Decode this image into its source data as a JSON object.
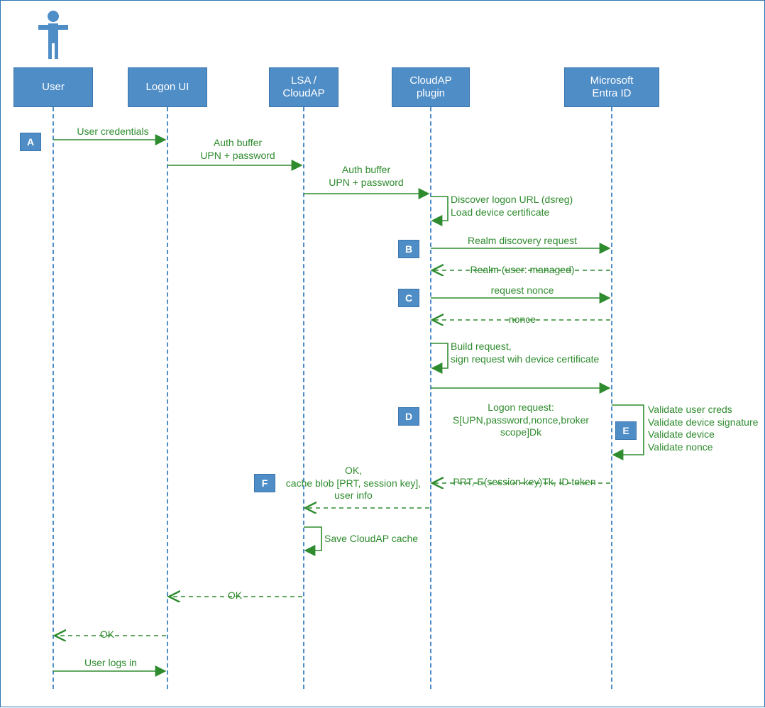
{
  "participants": {
    "user": "User",
    "logonui": "Logon UI",
    "lsa": "LSA /\nCloudAP",
    "cloudap": "CloudAP\nplugin",
    "entra": "Microsoft\nEntra ID"
  },
  "steps": {
    "A": "A",
    "B": "B",
    "C": "C",
    "D": "D",
    "E": "E",
    "F": "F"
  },
  "labels": {
    "user_creds": "User credentials",
    "auth_buffer1": "Auth buffer\nUPN + password",
    "auth_buffer2": "Auth buffer\nUPN + password",
    "discover": "Discover logon URL (dsreg)\nLoad device certificate",
    "realm_req": "Realm discovery request",
    "realm_resp": "Realm (user: managed)",
    "req_nonce": "request nonce",
    "nonce": "nonce",
    "build_req": "Build request,\nsign request wih device certificate",
    "logon_req": "Logon request:\nS[UPN,password,nonce,broker scope]Dk",
    "validate": "Validate user creds\nValidate device signature\nValidate device\nValidate nonce",
    "prt_resp": "PRT, E(session key)Tk, ID token",
    "ok_cache": "OK,\ncache blob [PRT, session key],\nuser info",
    "save_cache": "Save CloudAP cache",
    "ok1": "OK",
    "ok2": "OK",
    "user_logs_in": "User logs in"
  },
  "chart_data": {
    "type": "sequence-diagram",
    "participants": [
      "User",
      "Logon UI",
      "LSA / CloudAP",
      "CloudAP plugin",
      "Microsoft Entra ID"
    ],
    "messages": [
      {
        "step": "A",
        "from": "User",
        "to": "Logon UI",
        "label": "User credentials",
        "style": "solid"
      },
      {
        "from": "Logon UI",
        "to": "LSA / CloudAP",
        "label": "Auth buffer UPN + password",
        "style": "solid"
      },
      {
        "from": "LSA / CloudAP",
        "to": "CloudAP plugin",
        "label": "Auth buffer UPN + password",
        "style": "solid"
      },
      {
        "from": "CloudAP plugin",
        "to": "CloudAP plugin",
        "label": "Discover logon URL (dsreg) / Load device certificate",
        "style": "self"
      },
      {
        "step": "B",
        "from": "CloudAP plugin",
        "to": "Microsoft Entra ID",
        "label": "Realm discovery request",
        "style": "solid"
      },
      {
        "from": "Microsoft Entra ID",
        "to": "CloudAP plugin",
        "label": "Realm (user: managed)",
        "style": "dashed"
      },
      {
        "step": "C",
        "from": "CloudAP plugin",
        "to": "Microsoft Entra ID",
        "label": "request nonce",
        "style": "solid"
      },
      {
        "from": "Microsoft Entra ID",
        "to": "CloudAP plugin",
        "label": "nonce",
        "style": "dashed"
      },
      {
        "from": "CloudAP plugin",
        "to": "CloudAP plugin",
        "label": "Build request, sign request with device certificate",
        "style": "self"
      },
      {
        "step": "D",
        "from": "CloudAP plugin",
        "to": "Microsoft Entra ID",
        "label": "Logon request: S[UPN,password,nonce,broker scope]Dk",
        "style": "solid"
      },
      {
        "step": "E",
        "from": "Microsoft Entra ID",
        "to": "Microsoft Entra ID",
        "label": "Validate user creds / Validate device signature / Validate device / Validate nonce",
        "style": "self"
      },
      {
        "step": "F",
        "from": "Microsoft Entra ID",
        "to": "CloudAP plugin",
        "label": "PRT, E(session key)Tk, ID token",
        "style": "dashed"
      },
      {
        "from": "CloudAP plugin",
        "to": "LSA / CloudAP",
        "label": "OK, cache blob [PRT, session key], user info",
        "style": "dashed"
      },
      {
        "from": "LSA / CloudAP",
        "to": "LSA / CloudAP",
        "label": "Save CloudAP cache",
        "style": "self"
      },
      {
        "from": "LSA / CloudAP",
        "to": "Logon UI",
        "label": "OK",
        "style": "dashed"
      },
      {
        "from": "Logon UI",
        "to": "User",
        "label": "OK",
        "style": "dashed"
      },
      {
        "from": "User",
        "to": "Logon UI",
        "label": "User logs in",
        "style": "solid"
      }
    ]
  }
}
